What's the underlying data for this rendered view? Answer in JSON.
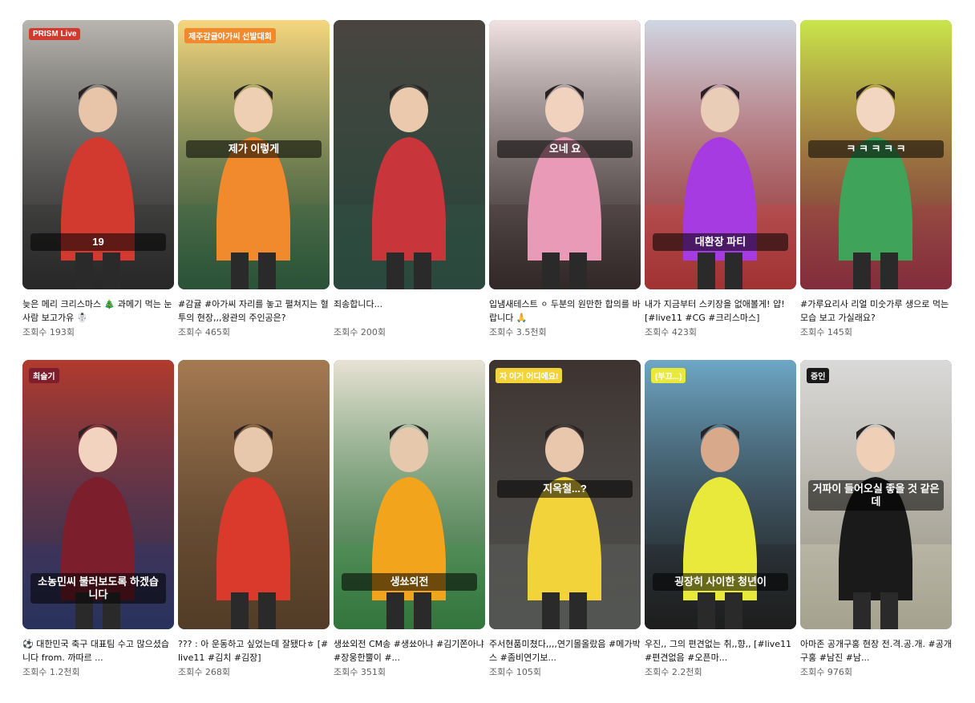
{
  "shorts": [
    {
      "title": "늦은 메리 크리스마스 🎄 과메기 먹는 눈사람 보고가유 ☃️",
      "views": "조회수 193회",
      "thumb": {
        "bg": "#b9b6b0",
        "accent": "#d23a2f",
        "accent2": "#2a2a2a",
        "face": "#e8c5a8"
      },
      "overlay_text": "19",
      "overlay_badge": "PRISM Live"
    },
    {
      "title": "#감귤 #아가씨 자리를 놓고 펼쳐지는 혈투의 현장,,,왕관의 주인공은?",
      "views": "조회수 465회",
      "thumb": {
        "bg": "#f7d77f",
        "accent": "#f08a2c",
        "accent2": "#2e6b45",
        "face": "#efcfb4"
      },
      "overlay_text": "제가 이렇게",
      "overlay_badge": "제주감귤아가씨 선발대회"
    },
    {
      "title": "죄송합니다...",
      "views": "조회수 200회",
      "thumb": {
        "bg": "#4a4440",
        "accent": "#c8353a",
        "accent2": "#2f5c4a",
        "face": "#eac9ad"
      },
      "overlay_text": "",
      "overlay_badge": ""
    },
    {
      "title": "입냄새테스트 ⚪ 두분의 원만한 합의를 바랍니다 🙏",
      "views": "조회수 3.5천회",
      "thumb": {
        "bg": "#f1e3e4",
        "accent": "#e89ab6",
        "accent2": "#3b2b2b",
        "face": "#f0d2bf"
      },
      "overlay_text": "오네 요",
      "overlay_badge": ""
    },
    {
      "title": "내가 지금부터 스키장을 없애볼게! 얍! [#live11 #CG #크리스마스]",
      "views": "조회수 423회",
      "thumb": {
        "bg": "#cfd7e3",
        "accent": "#a53be0",
        "accent2": "#e23a3a",
        "face": "#e9cdb6"
      },
      "overlay_text": "대환장 파티",
      "overlay_badge": ""
    },
    {
      "title": "#가루요리사 리얼 미숫가루 생으로 먹는 모습 보고 가실래요?",
      "views": "조회수 145회",
      "thumb": {
        "bg": "#c9e64a",
        "accent": "#3fa35a",
        "accent2": "#b5324a",
        "face": "#f3d6c2"
      },
      "overlay_text": "ㅋ ㅋ ㅋ ㅋ ㅋ",
      "overlay_badge": ""
    },
    {
      "title": "⚽ 대한민국 축구 대표팀 수고 많으셨습니다 from. 까따르 ...",
      "views": "조회수 1.2천회",
      "thumb": {
        "bg": "#b23a2c",
        "accent": "#7d1e2c",
        "accent2": "#2c3a7a",
        "face": "#f1d3c0"
      },
      "overlay_text": "소농민씨 불러보도록 하겠습니다",
      "overlay_badge": "최슬기"
    },
    {
      "title": "??? : 아 운동하고 싶었는데 잘됐다ㅎ [#live11 #김치 #김장]",
      "views": "조회수 268회",
      "thumb": {
        "bg": "#a57a52",
        "accent": "#d93a2c",
        "accent2": "#6b4a2a",
        "face": "#e8c8ad"
      },
      "overlay_text": "",
      "overlay_badge": ""
    },
    {
      "title": "생쑈외전 CM송 #생쑈아냐 #김기쫀아냐 #장웅한뿔이 #...",
      "views": "조회수 351회",
      "thumb": {
        "bg": "#e8e2d5",
        "accent": "#f2a41c",
        "accent2": "#3a9f4a",
        "face": "#e6c8ad"
      },
      "overlay_text": "생쑈외전",
      "overlay_badge": ""
    },
    {
      "title": "주서현품미쳤다,,,,연기몰올랐음 #메가박스 #좀비연기보...",
      "views": "조회수 105회",
      "thumb": {
        "bg": "#3d3330",
        "accent": "#f2d43a",
        "accent2": "#6c6e6a",
        "face": "#e8c7ad"
      },
      "overlay_text": "지옥철...?",
      "overlay_badge": "자 이거 어디에요!"
    },
    {
      "title": "우진,, 그의 편견없는 취,,향,, [#live11 #편견없음 #오픈마...",
      "views": "조회수 2.2천회",
      "thumb": {
        "bg": "#6ea7c6",
        "accent": "#e9e93c",
        "accent2": "#1c1c1c",
        "face": "#d9a98c"
      },
      "overlay_text": "굉장히 사이한 청년이",
      "overlay_badge": "(부끄...)"
    },
    {
      "title": "아마존 공개구홍 현장 전.격.공.개. #공개구홍 #남진 #남...",
      "views": "조회수 976회",
      "thumb": {
        "bg": "#d9d9d9",
        "accent": "#1a1a1a",
        "accent2": "#e9e2c8",
        "face": "#efcfb5"
      },
      "overlay_text": "거파이 들어오실 좋을 것 같은데",
      "overlay_badge": "증인"
    }
  ]
}
